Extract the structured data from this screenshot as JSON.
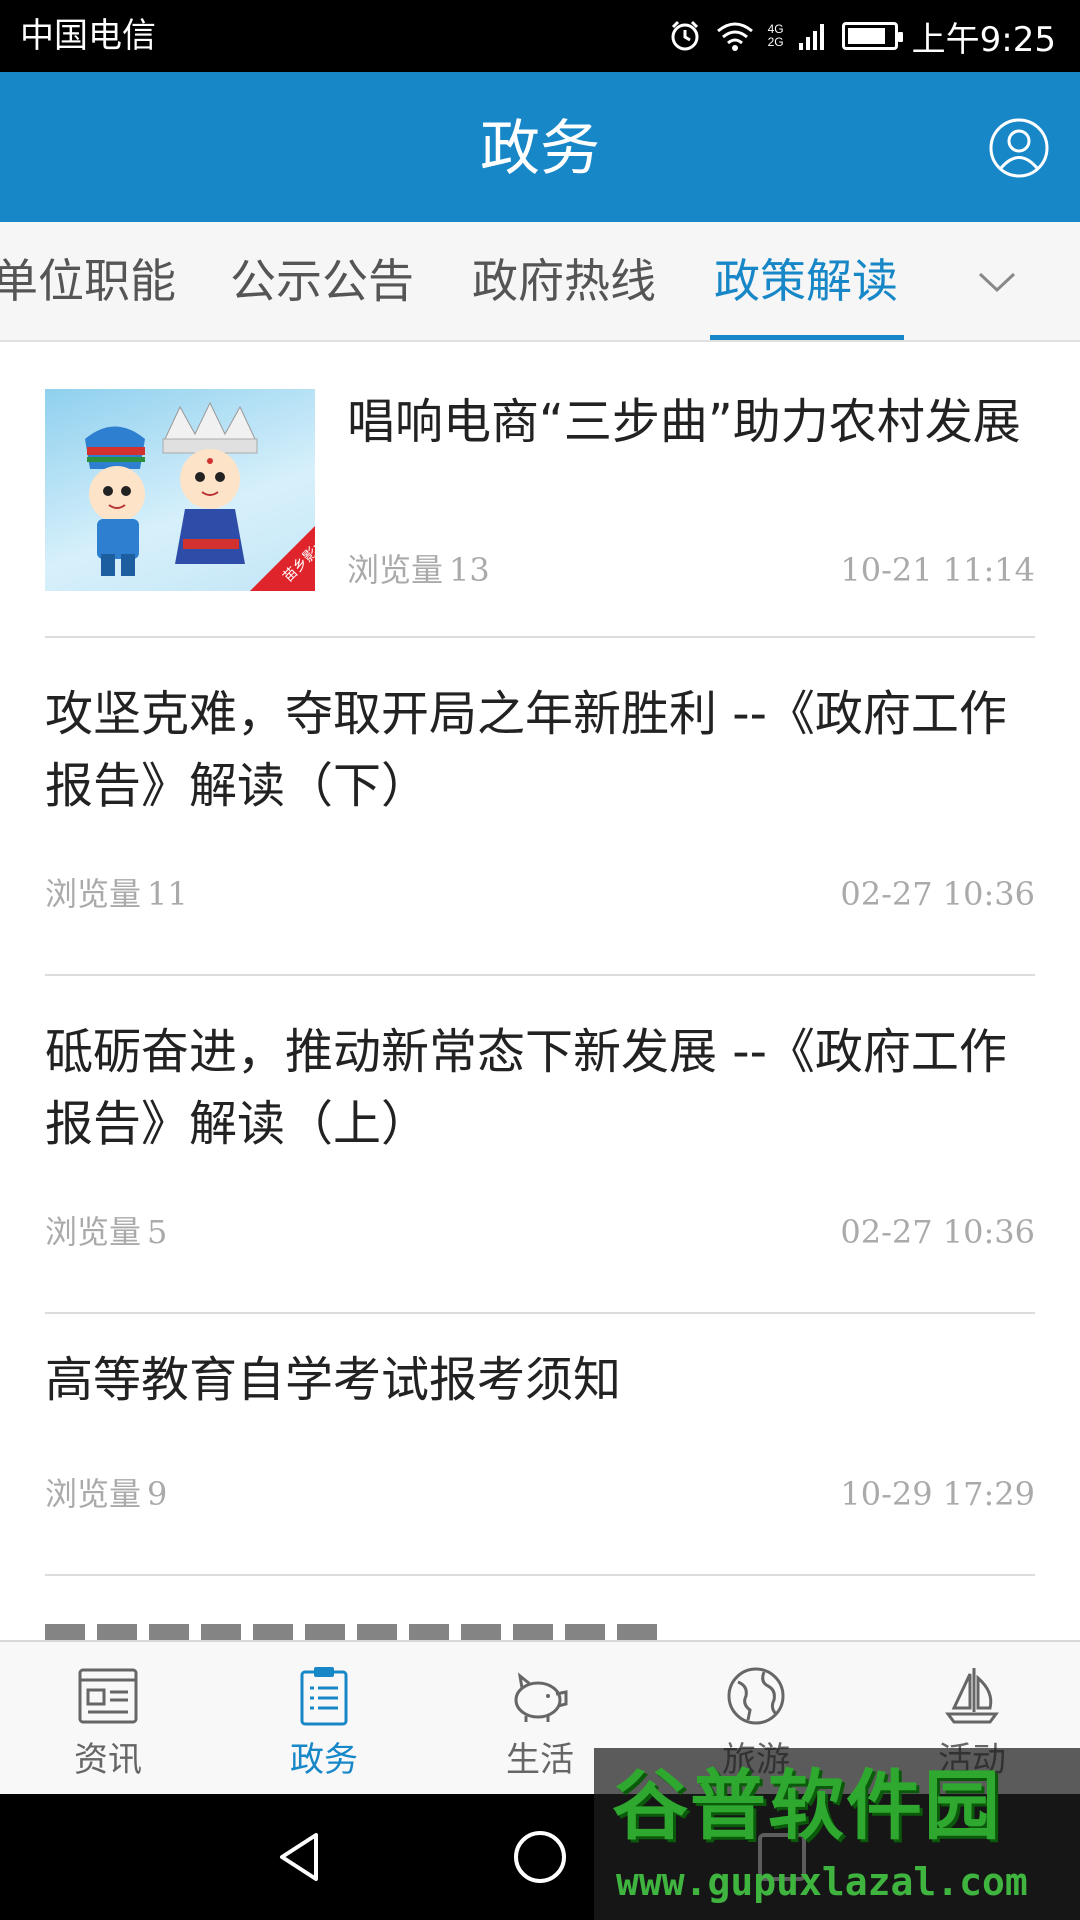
{
  "status_bar": {
    "carrier": "中国电信",
    "network_top": "4G",
    "network_bottom": "2G",
    "battery_level": 0.85,
    "time": "上午9:25"
  },
  "header": {
    "title": "政务",
    "user_icon": "user-profile-icon"
  },
  "tabs": {
    "items": [
      {
        "label": "单位职能"
      },
      {
        "label": "公示公告"
      },
      {
        "label": "政府热线"
      },
      {
        "label": "政策解读"
      }
    ],
    "active_index": 3,
    "more_icon": "chevron-down-icon"
  },
  "news": [
    {
      "title": "唱响电商“三步曲”助力农村发展",
      "views_label": "浏览量",
      "views": "13",
      "time": "10-21 11:14",
      "thumb_text": "苗乡影水"
    },
    {
      "title": "攻坚克难，夺取开局之年新胜利 --《政府工作报告》解读（下）",
      "views_label": "浏览量",
      "views": "11",
      "time": "02-27 10:36"
    },
    {
      "title": "砥砺奋进，推动新常态下新发展 --《政府工作报告》解读（上）",
      "views_label": "浏览量",
      "views": "5",
      "time": "02-27 10:36"
    },
    {
      "title": "高等教育自学考试报考须知",
      "views_label": "浏览量",
      "views": "9",
      "time": "10-29 17:29"
    }
  ],
  "bottom_nav": [
    {
      "label": "资讯",
      "icon": "news-icon"
    },
    {
      "label": "政务",
      "icon": "clipboard-icon"
    },
    {
      "label": "生活",
      "icon": "piggy-bank-icon"
    },
    {
      "label": "旅游",
      "icon": "globe-icon"
    },
    {
      "label": "活动",
      "icon": "sailboat-icon"
    }
  ],
  "bottom_nav_active": 1,
  "system_nav": [
    "back-icon",
    "home-icon",
    "recents-icon"
  ],
  "watermark": {
    "logo": "谷普软件园",
    "url": "www.gupuxlazal.com"
  },
  "colors": {
    "accent": "#1787c7",
    "status_bar": "#000000",
    "meta_text": "#aaaaaa"
  }
}
